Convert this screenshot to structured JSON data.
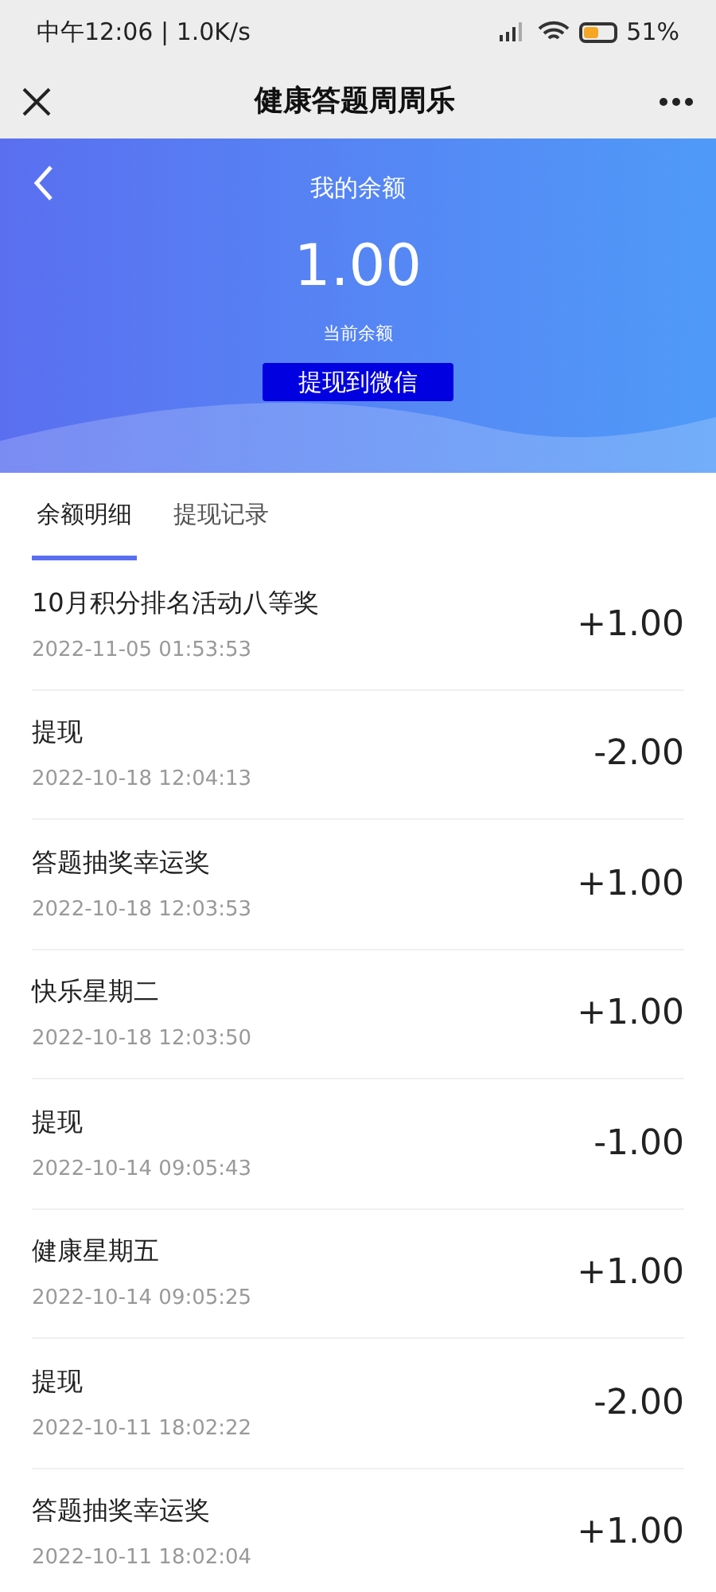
{
  "status_bar": {
    "time": "中午12:06 | 1.0K/s",
    "battery": "51%"
  },
  "nav": {
    "title": "健康答题周周乐"
  },
  "header": {
    "title": "我的余额",
    "balance": "1.00",
    "caption": "当前余额",
    "button": "提现到微信"
  },
  "tabs": [
    {
      "label": "余额明细",
      "selected": true
    },
    {
      "label": "提现记录",
      "selected": false
    }
  ],
  "records": [
    {
      "title": "10月积分排名活动八等奖",
      "time": "2022-11-05 01:53:53",
      "amount": "+1.00"
    },
    {
      "title": "提现",
      "time": "2022-10-18 12:04:13",
      "amount": "-2.00"
    },
    {
      "title": "答题抽奖幸运奖",
      "time": "2022-10-18 12:03:53",
      "amount": "+1.00"
    },
    {
      "title": "快乐星期二",
      "time": "2022-10-18 12:03:50",
      "amount": "+1.00"
    },
    {
      "title": "提现",
      "time": "2022-10-14 09:05:43",
      "amount": "-1.00"
    },
    {
      "title": "健康星期五",
      "time": "2022-10-14 09:05:25",
      "amount": "+1.00"
    },
    {
      "title": "提现",
      "time": "2022-10-11 18:02:22",
      "amount": "-2.00"
    },
    {
      "title": "答题抽奖幸运奖",
      "time": "2022-10-11 18:02:04",
      "amount": "+1.00"
    }
  ]
}
